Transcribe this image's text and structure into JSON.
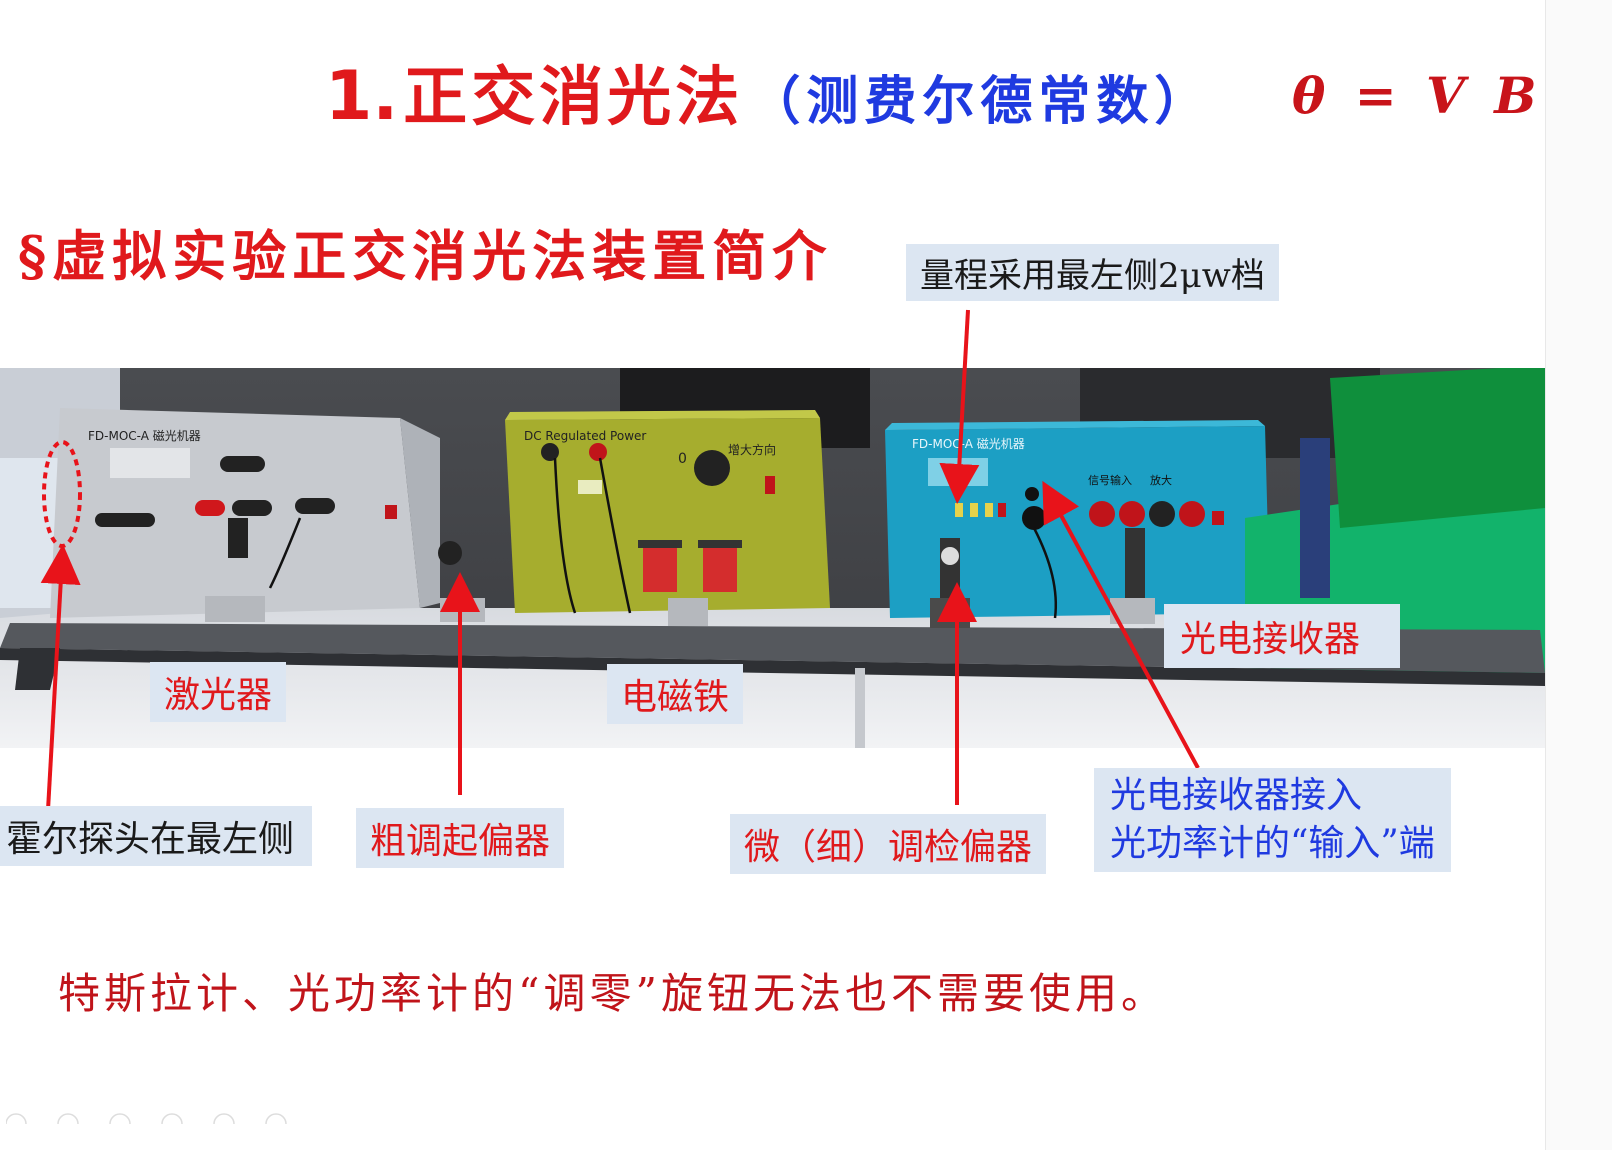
{
  "title": {
    "number": "1.",
    "main": "正交消光法",
    "subtitle": "（测费尔德常数）",
    "formula": "θ = V B d"
  },
  "section_heading": "§虚拟实验正交消光法装置简介",
  "apparatus_text": {
    "left_unit": "FD-MOC-A 磁光机器",
    "power_supply": "DC Regulated Power",
    "power_knob_label": "增大方向",
    "power_zero": "0",
    "right_unit": "FD-MOC-A 磁光机器",
    "right_signal_in": "信号输入",
    "right_amp": "放大"
  },
  "labels": {
    "range_note": "量程采用最左侧2μw档",
    "laser": "激光器",
    "electromagnet": "电磁铁",
    "photo_receiver": "光电接收器",
    "hall_probe": "霍尔探头在最左侧",
    "coarse_polarizer": "粗调起偏器",
    "fine_analyzer": "微（细）调检偏器",
    "receiver_connect_line1": "光电接收器接入",
    "receiver_connect_line2": "光功率计的“输入”端"
  },
  "bottom_note": "特斯拉计、光功率计的“调零”旋钮无法也不需要使用。",
  "colors": {
    "title_red": "#e0191c",
    "title_blue": "#1f3ae0",
    "label_bg": "#dce6f2",
    "arrow_red": "#e8131a"
  }
}
